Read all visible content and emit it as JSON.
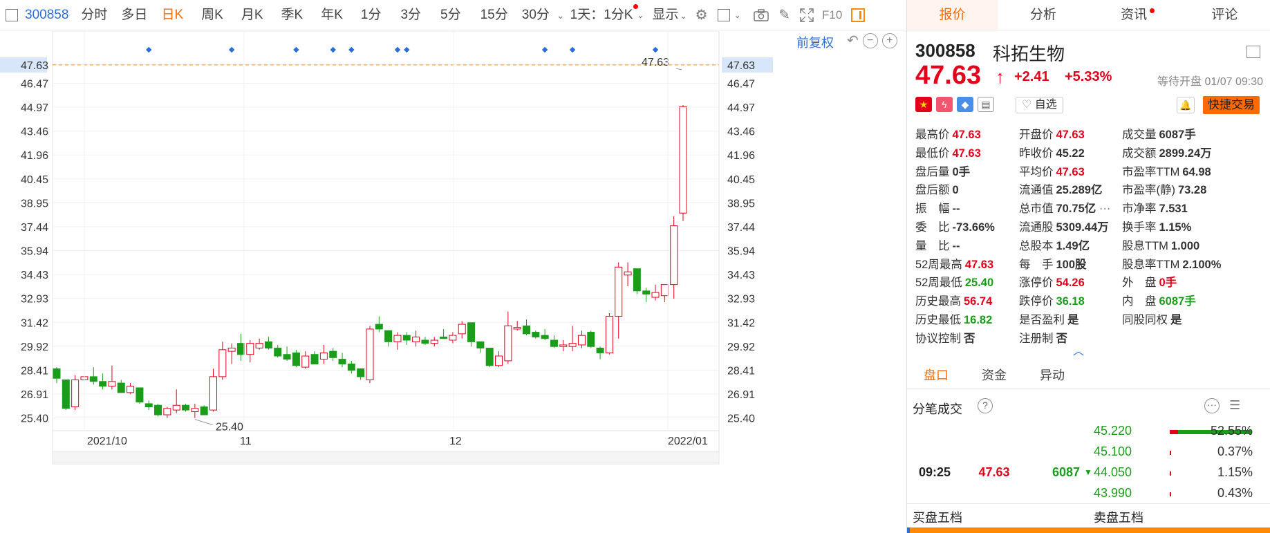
{
  "toolbar": {
    "code": "300858",
    "items": [
      "分时",
      "多日",
      "日K",
      "周K",
      "月K",
      "季K",
      "年K",
      "1分",
      "3分",
      "5分",
      "15分",
      "30分"
    ],
    "active": "日K",
    "period_select": "1天：1分K",
    "display": "显示"
  },
  "chart_controls": {
    "fuquan": "前复权"
  },
  "chart_data": {
    "type": "candlestick",
    "x_ticks": [
      "2021/10",
      "11",
      "12",
      "2022/01"
    ],
    "y_ticks": [
      47.63,
      46.47,
      44.97,
      43.46,
      41.96,
      40.45,
      38.95,
      37.44,
      35.94,
      34.43,
      32.93,
      31.42,
      29.92,
      28.41,
      26.91,
      25.4
    ],
    "ylim": [
      24.6,
      48.8
    ],
    "current_price_line": 47.63,
    "max_label": "47.63",
    "min_label": "25.40",
    "colors": {
      "up": "#e4001a",
      "down": "#1a9e1a",
      "price_line": "#f5a623",
      "marker": "#2b6fd6"
    },
    "candles": [
      [
        28.5,
        28.6,
        27.6,
        27.9
      ],
      [
        27.8,
        27.8,
        25.9,
        26.0
      ],
      [
        26.1,
        28.1,
        25.9,
        27.8
      ],
      [
        27.8,
        28.1,
        27.6,
        28.0
      ],
      [
        28.0,
        28.6,
        27.5,
        27.7
      ],
      [
        27.7,
        28.2,
        27.2,
        27.4
      ],
      [
        27.4,
        28.7,
        27.2,
        27.7
      ],
      [
        27.6,
        27.8,
        27.0,
        27.0
      ],
      [
        27.0,
        27.6,
        26.9,
        27.4
      ],
      [
        27.3,
        27.3,
        26.3,
        26.4
      ],
      [
        26.3,
        26.5,
        25.9,
        26.1
      ],
      [
        26.2,
        26.3,
        25.5,
        25.6
      ],
      [
        25.6,
        26.1,
        25.4,
        26.0
      ],
      [
        25.9,
        27.2,
        25.7,
        26.2
      ],
      [
        26.2,
        26.3,
        25.8,
        25.9
      ],
      [
        25.8,
        26.3,
        25.4,
        26.0
      ],
      [
        26.1,
        26.2,
        25.7,
        25.6
      ],
      [
        25.9,
        28.5,
        25.8,
        28.0
      ],
      [
        28.0,
        30.2,
        27.8,
        29.7
      ],
      [
        29.6,
        30.1,
        28.8,
        29.8
      ],
      [
        30.1,
        30.7,
        29.0,
        29.4
      ],
      [
        29.4,
        30.3,
        28.9,
        30.1
      ],
      [
        29.8,
        30.4,
        29.7,
        30.1
      ],
      [
        30.2,
        30.5,
        29.7,
        29.8
      ],
      [
        29.8,
        30.0,
        29.2,
        29.3
      ],
      [
        29.4,
        29.9,
        29.0,
        29.1
      ],
      [
        29.5,
        29.7,
        28.6,
        28.7
      ],
      [
        28.6,
        29.6,
        28.5,
        29.3
      ],
      [
        29.4,
        29.6,
        28.8,
        28.8
      ],
      [
        29.1,
        30.0,
        28.8,
        29.5
      ],
      [
        29.6,
        29.8,
        29.0,
        29.2
      ],
      [
        29.1,
        29.5,
        28.6,
        28.8
      ],
      [
        28.8,
        29.0,
        28.2,
        28.4
      ],
      [
        28.5,
        28.5,
        27.8,
        28.0
      ],
      [
        27.8,
        31.2,
        27.6,
        31.0
      ],
      [
        31.3,
        31.8,
        30.8,
        31.0
      ],
      [
        30.9,
        30.9,
        29.9,
        30.2
      ],
      [
        30.2,
        30.8,
        29.7,
        30.6
      ],
      [
        30.6,
        30.8,
        30.0,
        30.3
      ],
      [
        30.2,
        30.9,
        29.9,
        30.5
      ],
      [
        30.3,
        30.5,
        30.0,
        30.1
      ],
      [
        30.1,
        30.5,
        29.9,
        30.3
      ],
      [
        30.5,
        31.0,
        30.4,
        30.4
      ],
      [
        30.3,
        30.8,
        30.1,
        30.6
      ],
      [
        30.7,
        31.5,
        30.4,
        31.3
      ],
      [
        31.4,
        31.4,
        29.9,
        30.2
      ],
      [
        30.2,
        30.2,
        29.5,
        29.8
      ],
      [
        29.8,
        29.8,
        28.6,
        28.7
      ],
      [
        28.7,
        29.6,
        28.6,
        29.3
      ],
      [
        29.0,
        32.1,
        28.8,
        31.2
      ],
      [
        31.0,
        31.5,
        30.9,
        31.1
      ],
      [
        31.2,
        31.6,
        30.6,
        30.7
      ],
      [
        30.8,
        30.9,
        30.4,
        30.5
      ],
      [
        30.6,
        31.0,
        30.3,
        30.4
      ],
      [
        30.3,
        30.6,
        29.8,
        29.9
      ],
      [
        29.9,
        30.3,
        29.6,
        30.0
      ],
      [
        29.9,
        31.2,
        29.6,
        30.1
      ],
      [
        30.0,
        30.9,
        29.8,
        30.6
      ],
      [
        30.8,
        30.9,
        29.8,
        29.9
      ],
      [
        29.8,
        29.9,
        29.1,
        29.5
      ],
      [
        29.5,
        32.0,
        29.4,
        31.8
      ],
      [
        31.8,
        35.2,
        30.4,
        34.9
      ],
      [
        34.4,
        35.2,
        33.7,
        34.6
      ],
      [
        34.8,
        34.8,
        33.2,
        33.4
      ],
      [
        33.4,
        33.6,
        32.7,
        33.2
      ],
      [
        33.0,
        33.8,
        32.8,
        33.3
      ],
      [
        33.1,
        33.8,
        32.7,
        33.8
      ],
      [
        33.8,
        38.1,
        32.9,
        37.5
      ],
      [
        38.3,
        45.1,
        37.8,
        45.0
      ]
    ],
    "markers": [
      10,
      19,
      26,
      30,
      32,
      37,
      38,
      53,
      56,
      65
    ]
  },
  "tabs": [
    "报价",
    "分析",
    "资讯",
    "评论"
  ],
  "stock": {
    "code": "300858",
    "name": "科拓生物",
    "price": "47.63",
    "change": "+2.41",
    "change_pct": "+5.33%",
    "status": "等待开盘 01/07 09:30",
    "zixuan": "自选",
    "quick_trade": "快捷交易"
  },
  "stats": [
    [
      [
        "最高价",
        "47.63",
        "red"
      ],
      [
        "开盘价",
        "47.63",
        "red"
      ],
      [
        "成交量",
        "6087手",
        "dark"
      ]
    ],
    [
      [
        "最低价",
        "47.63",
        "red"
      ],
      [
        "昨收价",
        "45.22",
        "dark"
      ],
      [
        "成交额",
        "2899.24万",
        "dark"
      ]
    ],
    [
      [
        "盘后量",
        "0手",
        "dark"
      ],
      [
        "平均价",
        "47.63",
        "red"
      ],
      [
        "市盈率TTM",
        "64.98",
        "dark"
      ]
    ],
    [
      [
        "盘后额",
        "0",
        "dark"
      ],
      [
        "流通值",
        "25.289亿",
        "dark"
      ],
      [
        "市盈率(静)",
        "73.28",
        "dark"
      ]
    ],
    [
      [
        "振　幅",
        "--",
        "dark"
      ],
      [
        "总市值",
        "70.75亿",
        "dark"
      ],
      [
        "市净率",
        "7.531",
        "dark"
      ]
    ],
    [
      [
        "委　比",
        "-73.66%",
        "dark"
      ],
      [
        "流通股",
        "5309.44万",
        "dark"
      ],
      [
        "换手率",
        "1.15%",
        "dark"
      ]
    ],
    [
      [
        "量　比",
        "--",
        "dark"
      ],
      [
        "总股本",
        "1.49亿",
        "dark"
      ],
      [
        "股息TTM",
        "1.000",
        "dark"
      ]
    ],
    [
      [
        "52周最高",
        "47.63",
        "red"
      ],
      [
        "每　手",
        "100股",
        "dark"
      ],
      [
        "股息率TTM",
        "2.100%",
        "dark"
      ]
    ],
    [
      [
        "52周最低",
        "25.40",
        "green"
      ],
      [
        "涨停价",
        "54.26",
        "red"
      ],
      [
        "外　盘",
        "0手",
        "red"
      ]
    ],
    [
      [
        "历史最高",
        "56.74",
        "red"
      ],
      [
        "跌停价",
        "36.18",
        "green"
      ],
      [
        "内　盘",
        "6087手",
        "green"
      ]
    ],
    [
      [
        "历史最低",
        "16.82",
        "green"
      ],
      [
        "是否盈利",
        "是",
        "dark"
      ],
      [
        "同股同权",
        "是",
        "dark"
      ]
    ],
    [
      [
        "协议控制",
        "否",
        "dark"
      ],
      [
        "注册制",
        "否",
        "dark"
      ],
      [
        "",
        "",
        "dark"
      ]
    ]
  ],
  "subtabs": [
    "盘口",
    "资金",
    "异动"
  ],
  "fenbi": {
    "title": "分笔成交",
    "trade": {
      "time": "09:25",
      "price": "47.63",
      "volume": "6087"
    },
    "dist": [
      {
        "price": "45.220",
        "pct": "52.55%"
      },
      {
        "price": "45.100",
        "pct": "0.37%"
      },
      {
        "price": "44.050",
        "pct": "1.15%"
      },
      {
        "price": "43.990",
        "pct": "0.43%"
      }
    ]
  },
  "wudang": {
    "buy": "买盘五档",
    "sell": "卖盘五档"
  }
}
